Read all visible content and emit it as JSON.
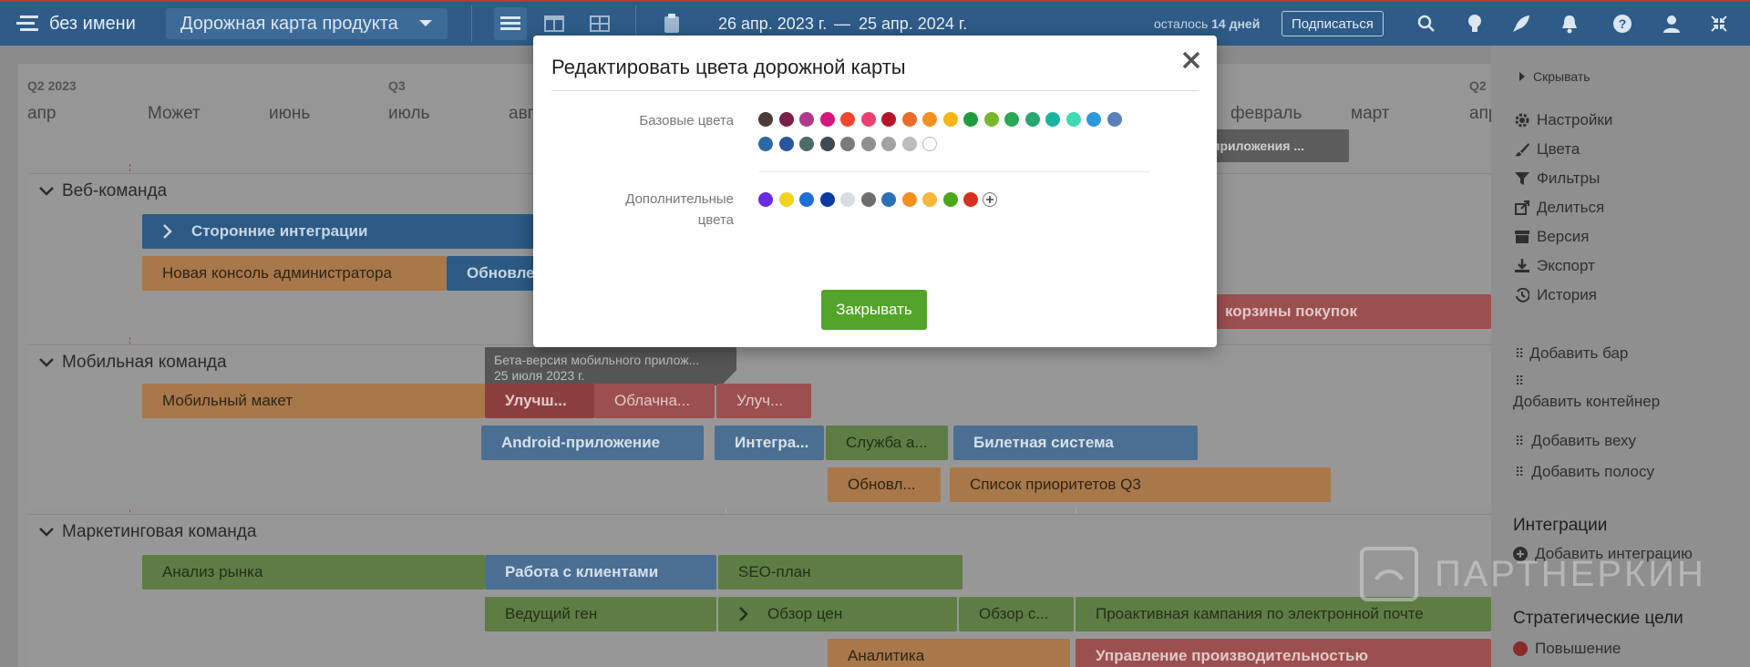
{
  "topbar": {
    "app_title": "без имени",
    "roadmap_select": "Дорожная карта продукта",
    "date_from": "26 апр. 2023 г.",
    "date_sep": "—",
    "date_to": "25 апр. 2024 г.",
    "trial_prefix": "осталось",
    "trial_days": "14 дней",
    "subscribe": "Подписаться"
  },
  "timeline": {
    "quarters": [
      "Q2 2023",
      "Q3",
      "Q2"
    ],
    "months": [
      "апр",
      "Может",
      "июнь",
      "июль",
      "авг",
      "февраль",
      "март",
      "апр"
    ]
  },
  "teams": [
    {
      "name": "Веб-команда"
    },
    {
      "name": "Мобильная команда"
    },
    {
      "name": "Маркетинговая команда"
    }
  ],
  "bars": {
    "third_party": "Сторонние интеграции",
    "admin_console": "Новая консоль администратора",
    "updates": "Обновле",
    "cart": "корзины покупок",
    "app_milestone": "приложения ...",
    "mobile_beta_title": "Бета-версия мобильного прилож...",
    "mobile_beta_date": "25 июля 2023 г.",
    "mobile_layout": "Мобильный макет",
    "improve": "Улучш...",
    "cloud": "Облачна...",
    "improve2": "Улуч...",
    "android": "Android-приложение",
    "integra": "Интегра...",
    "service": "Служба а...",
    "ticket": "Билетная система",
    "update2": "Обновл...",
    "q3_list": "Список приоритетов Q3",
    "market_analysis": "Анализ рынка",
    "clients": "Работа с клиентами",
    "seo": "SEO-план",
    "lead_gen": "Ведущий ген",
    "price_review": "Обзор цен",
    "review_c": "Обзор с...",
    "email_campaign": "Проактивная кампания по электронной почте",
    "analytics": "Аналитика",
    "perf_mgmt": "Управление производительностью"
  },
  "sidebar": {
    "hide": "Скрывать",
    "items": [
      "Настройки",
      "Цвета",
      "Фильтры",
      "Делиться",
      "Версия",
      "Экспорт",
      "История"
    ],
    "add_items": [
      "Добавить бар",
      "Добавить контейнер",
      "Добавить веху",
      "Добавить полосу"
    ],
    "integrations_title": "Интеграции",
    "add_integration": "Добавить интеграцию",
    "goals_title": "Стратегические цели",
    "goal_1": "Повышение"
  },
  "modal": {
    "title": "Редактировать цвета дорожной карты",
    "base_label": "Базовые цвета",
    "extra_label_1": "Дополнительные",
    "extra_label_2": "цвета",
    "close_button": "Закрывать",
    "base_colors": [
      "#4a3a3a",
      "#7a1f4b",
      "#b03a8a",
      "#d4167d",
      "#f0452e",
      "#ec3f6f",
      "#b5172a",
      "#ef6a2a",
      "#f5901e",
      "#f7b615",
      "#1f9d3b",
      "#78b82a",
      "#2aa853",
      "#27a86f",
      "#1bb3a0",
      "#3ddab3",
      "#2e98d8",
      "#5b7fb8",
      "#2c6aa6",
      "#24579e",
      "#4e6b6b",
      "#3f4a55",
      "#7a7a7a",
      "#8f8f8f",
      "#a3a3a3",
      "#bdbdbd",
      "#ffffff"
    ],
    "extra_colors": [
      "#6a2ce0",
      "#f1d21c",
      "#1f6fd6",
      "#0b3aa4",
      "#d9dde0",
      "#6e6e6e",
      "#2a72b8",
      "#f3901f",
      "#f7b83a",
      "#4aa81c",
      "#d9301e"
    ]
  },
  "watermark": "ПАРТНЕРКИН"
}
